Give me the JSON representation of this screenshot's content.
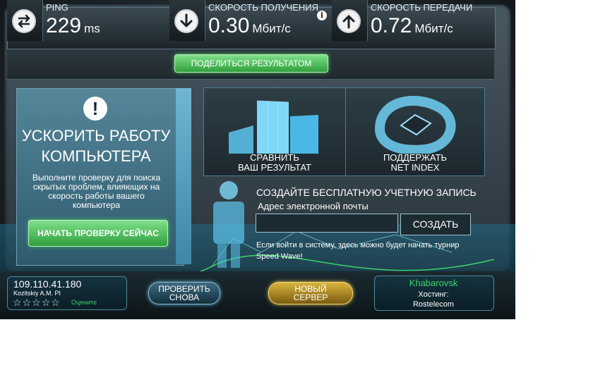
{
  "colors": {
    "accent_green": "#3cd26a",
    "gold": "#e6c34a",
    "panel": "#2e3e46"
  },
  "metrics": [
    {
      "label": "PING",
      "value": "229",
      "unit": "ms",
      "icon": "arrows-exchange-icon"
    },
    {
      "label": "СКОРОСТЬ ПОЛУЧЕНИЯ",
      "value": "0.30",
      "unit": "Мбит/с",
      "icon": "download-arrow-icon"
    },
    {
      "label": "СКОРОСТЬ ПЕРЕДАЧИ",
      "value": "0.72",
      "unit": "Мбит/с",
      "icon": "upload-arrow-icon"
    }
  ],
  "info_icon": "i",
  "share_button": "ПОДЕЛИТЬСЯ РЕЗУЛЬТАТОМ",
  "promo": {
    "exclamation": "!",
    "title_line1": "УСКОРИТЬ РАБОТУ",
    "title_line2": "КОМПЬЮТЕРА",
    "description": "Выполните проверку для поиска скрытых проблем, влияющих на скорость работы вашего компьютера",
    "button": "НАЧАТЬ ПРОВЕРКУ СЕЙЧАС"
  },
  "tiles": [
    {
      "line1": "СРАВНИТЬ",
      "line2": "ВАШ РЕЗУЛЬТАТ",
      "icon": "bar-chart-icon"
    },
    {
      "line1": "ПОДДЕРЖАТЬ",
      "line2": "NET INDEX",
      "icon": "net-index-icon"
    }
  ],
  "signup": {
    "title": "СОЗДАЙТЕ БЕСПЛАТНУЮ УЧЕТНУЮ ЗАПИСЬ",
    "email_label": "Адрес электронной почты",
    "email_value": "",
    "create_button": "СОЗДАТЬ",
    "note": "Если войти в систему, здесь можно будет начать турнир Speed Wave!"
  },
  "footer": {
    "ip": "109.110.41.180",
    "isp": "Kozitskiy A.M. PI",
    "rating_stars": 0,
    "rating_max": 5,
    "rate_label": "Оцените",
    "retest_line1": "ПРОВЕРИТЬ",
    "retest_line2": "СНОВА",
    "newserver_line1": "НОВЫЙ",
    "newserver_line2": "СЕРВЕР",
    "city": "Khabarovsk",
    "hosting_label": "Хостинг:",
    "host": "Rostelecom"
  }
}
